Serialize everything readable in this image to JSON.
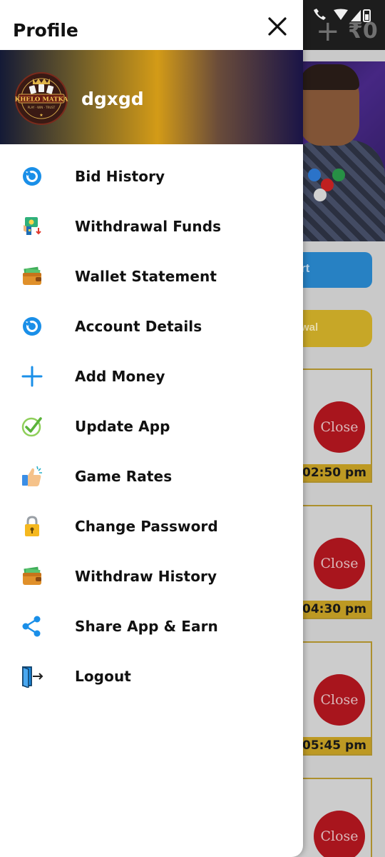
{
  "app": {
    "title": "Profile",
    "balance": "₹0"
  },
  "profile": {
    "username": "dgxgd",
    "logo_text": "KHELO MATKA",
    "logo_tagline": "PLAY · WIN · TRUST"
  },
  "menu": {
    "items": [
      {
        "label": "Bid History",
        "icon": "history-icon"
      },
      {
        "label": "Withdrawal Funds",
        "icon": "withdraw-funds-icon"
      },
      {
        "label": "Wallet Statement",
        "icon": "wallet-icon"
      },
      {
        "label": "Account Details",
        "icon": "account-icon"
      },
      {
        "label": "Add Money",
        "icon": "plus-icon"
      },
      {
        "label": "Update App",
        "icon": "check-icon"
      },
      {
        "label": "Game Rates",
        "icon": "thumbs-up-icon"
      },
      {
        "label": "Change Password",
        "icon": "lock-icon"
      },
      {
        "label": "Withdraw History",
        "icon": "wallet-icon"
      },
      {
        "label": "Share App & Earn",
        "icon": "share-icon"
      },
      {
        "label": "Logout",
        "icon": "logout-icon"
      }
    ]
  },
  "background": {
    "buttons": [
      "rt",
      "wal"
    ],
    "games": [
      {
        "status": "Close",
        "time": "02:50 pm"
      },
      {
        "status": "Close",
        "time": "04:30 pm"
      },
      {
        "status": "Close",
        "time": "05:45 pm"
      },
      {
        "status": "Close",
        "time": ""
      }
    ]
  },
  "colors": {
    "accent_blue": "#1a8fe8",
    "gold": "#d39b17",
    "close_red": "#c3141c",
    "drawer_bg": "#ffffff"
  }
}
